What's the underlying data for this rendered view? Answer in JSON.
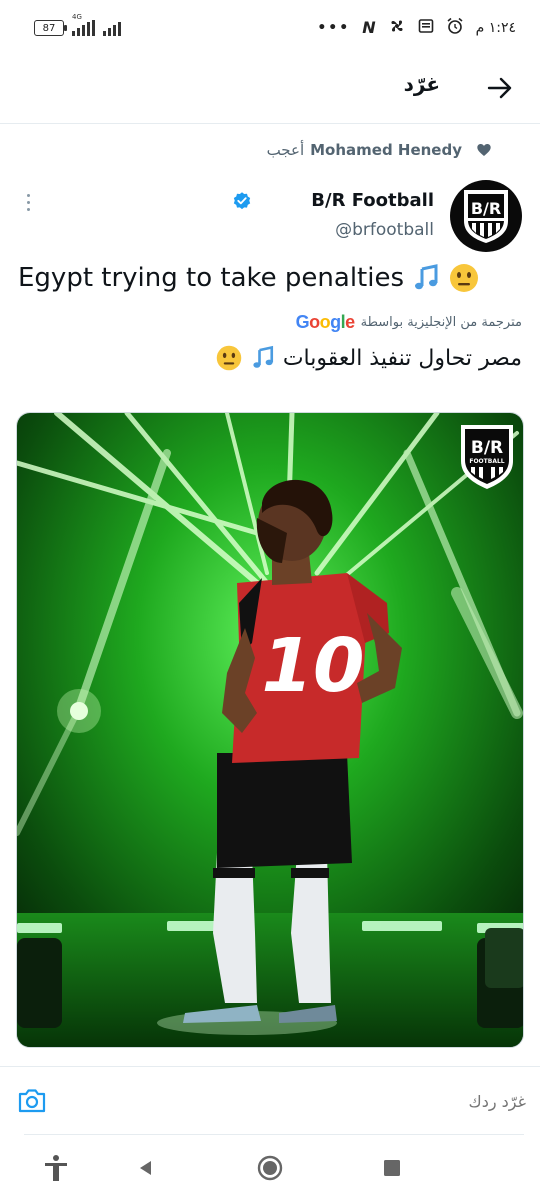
{
  "status_bar": {
    "battery": "87",
    "network": "4G",
    "time": "١:٢٤ م",
    "dots": "•••",
    "n_icon": "N"
  },
  "header": {
    "title": "غرّد",
    "back_icon": "arrow-right-icon"
  },
  "social_context": {
    "name": "Mohamed Henedy",
    "action": "أعجب",
    "icon": "heart-icon"
  },
  "tweet": {
    "display_name": "B/R Football",
    "handle": "@brfootball",
    "text": "Egypt trying to take penalties",
    "translated_by": "مترجمة من الإنجليزية بواسطة",
    "translated_text": "مصر تحاول تنفيذ العقوبات",
    "avatar_text": "B/R",
    "media": {
      "logo_text": "B/R",
      "logo_sub": "FOOTBALL",
      "jersey_number": "10"
    }
  },
  "reply": {
    "placeholder": "غرّد ردك",
    "camera_icon": "camera-icon"
  },
  "colors": {
    "verified": "#1d9bf0",
    "text_secondary": "#536471",
    "media_green": "#2fd12f"
  }
}
